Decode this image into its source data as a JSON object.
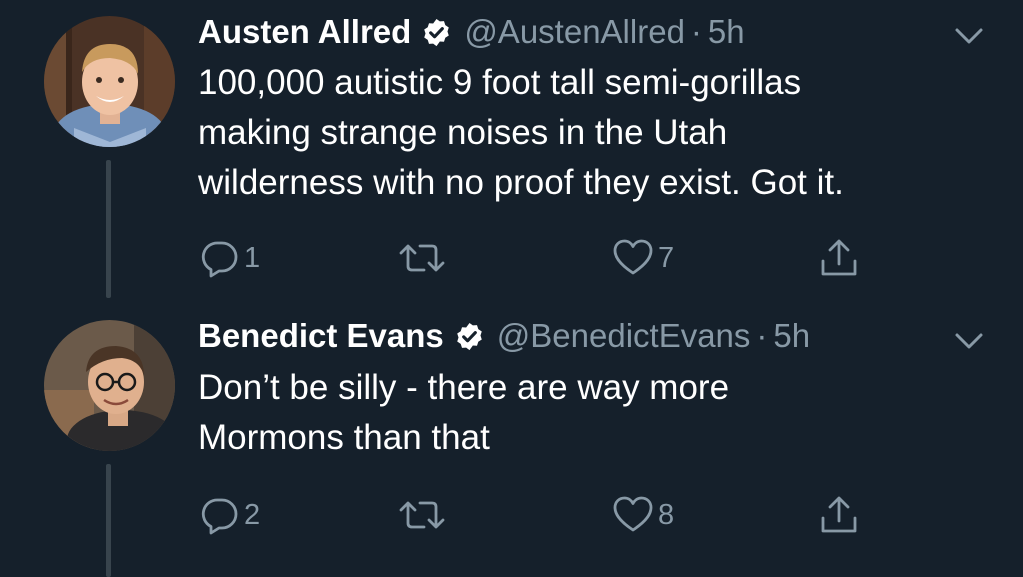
{
  "tweets": [
    {
      "display_name": "Austen Allred",
      "handle": "@AustenAllred",
      "separator": "·",
      "time": "5h",
      "text": "100,000 autistic 9 foot tall semi-gorillas\nmaking strange noises in the Utah\nwilderness with no proof they exist. Got it.",
      "replies": "1",
      "retweets": "",
      "likes": "7",
      "verified": true
    },
    {
      "display_name": "Benedict Evans",
      "handle": "@BenedictEvans",
      "separator": "·",
      "time": "5h",
      "text": "Don’t be silly - there are way more\nMormons than that",
      "replies": "2",
      "retweets": "",
      "likes": "8",
      "verified": true
    }
  ],
  "icons": {
    "reply": "reply-icon",
    "retweet": "retweet-icon",
    "like": "heart-icon",
    "share": "share-icon",
    "verified": "verified-badge-icon",
    "menu": "chevron-down-icon"
  },
  "colors": {
    "background": "#15202b",
    "text": "#ffffff",
    "secondary": "#8899a6",
    "verified_badge": "#ffffff",
    "thread_line": "#38444d"
  }
}
